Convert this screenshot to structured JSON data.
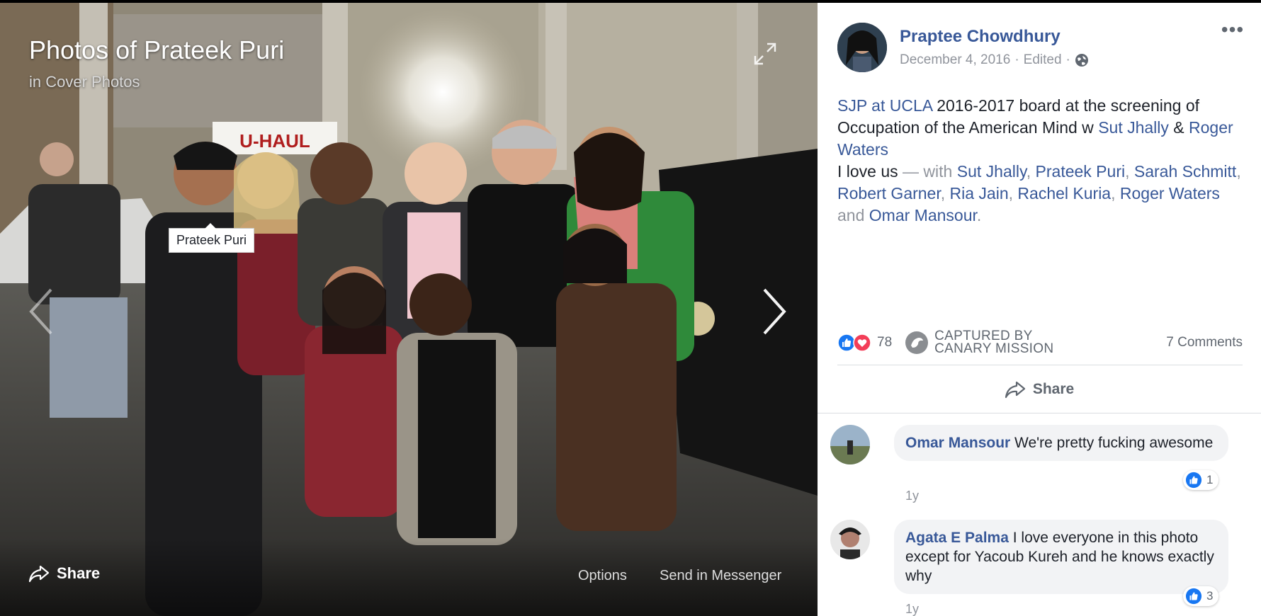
{
  "viewer": {
    "title": "Photos of Prateek Puri",
    "subtitle": "in Cover Photos",
    "tag_label": "Prateek Puri",
    "share_label": "Share",
    "options_label": "Options",
    "messenger_label": "Send in Messenger",
    "photo_signage": "U-HAUL"
  },
  "post": {
    "author": "Praptee Chowdhury",
    "date": "December 4, 2016",
    "edited": "Edited",
    "text": {
      "p1_link1": "SJP at UCLA",
      "p1_text1": " 2016-2017 board at the screening of Occupation of the American Mind w ",
      "p1_link2": "Sut Jhally",
      "p1_text2": " & ",
      "p1_link3": "Roger Waters",
      "p2_text": "I love us ",
      "p2_with": "— with ",
      "tags": [
        "Sut Jhally",
        "Prateek Puri",
        "Sarah Schmitt",
        "Robert Garner",
        "Ria Jain",
        "Rachel Kuria",
        "Roger Waters",
        "Omar Mansour"
      ],
      "sep": ", ",
      "and": " and ",
      "end": "."
    },
    "reaction_count": "78",
    "canary_line1": "CAPTURED BY",
    "canary_line2": "CANARY MISSION",
    "comments_count": "7 Comments",
    "share_label": "Share"
  },
  "comments": [
    {
      "name": "Omar Mansour",
      "text": " We're pretty fucking awesome",
      "time": "1y",
      "likes": "1"
    },
    {
      "name": "Agata E Palma",
      "text": " I love everyone in this photo except for Yacoub Kureh and he knows exactly why",
      "time": "1y",
      "likes": "3"
    }
  ],
  "colors": {
    "link": "#385898",
    "like_blue": "#1877f2",
    "love_red": "#f33e58"
  }
}
